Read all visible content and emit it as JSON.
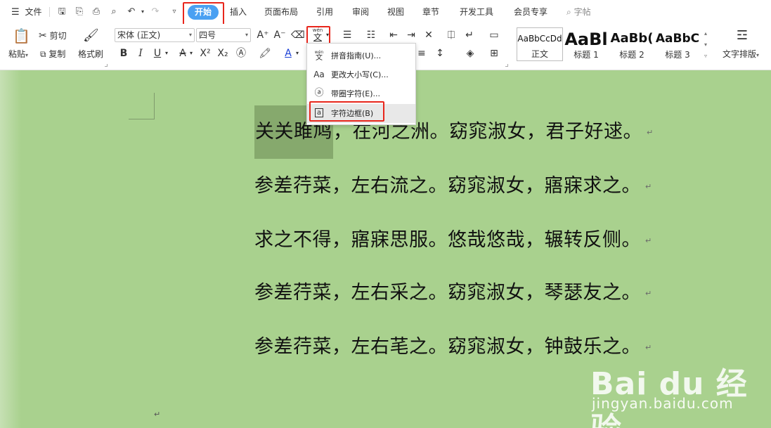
{
  "menubar": {
    "file_label": "文件",
    "tabs": [
      "开始",
      "插入",
      "页面布局",
      "引用",
      "审阅",
      "视图",
      "章节",
      "开发工具",
      "会员专享"
    ],
    "search_label": "字帖"
  },
  "ribbon": {
    "paste_label": "粘贴",
    "cut_label": "剪切",
    "copy_label": "复制",
    "format_painter_label": "格式刷",
    "font_name": "宋体 (正文)",
    "font_size": "四号",
    "styles": [
      {
        "sample": "AaBbCcDd",
        "name": "正文"
      },
      {
        "sample": "AaBl",
        "name": "标题 1"
      },
      {
        "sample": "AaBb(",
        "name": "标题 2"
      },
      {
        "sample": "AaBbC",
        "name": "标题 3"
      }
    ],
    "text_layout_label": "文字排版",
    "icon_glyphs": {
      "pinyin": "文",
      "pinyin_top": "wén"
    }
  },
  "dropdown": {
    "items": [
      {
        "label": "拼音指南(U)...",
        "icon": "pinyin-icon"
      },
      {
        "label": "更改大小写(C)...",
        "icon": "change-case-icon"
      },
      {
        "label": "带圈字符(E)...",
        "icon": "enclosed-char-icon"
      },
      {
        "label": "字符边框(B)",
        "icon": "char-border-icon"
      }
    ]
  },
  "document": {
    "lines": [
      {
        "selected": "关关雎鸠",
        "rest": "，在河之洲。窈窕淑女，君子好逑。"
      },
      {
        "selected": "",
        "rest": "参差荇菜，左右流之。窈窕淑女，寤寐求之。"
      },
      {
        "selected": "",
        "rest": "求之不得，寤寐思服。悠哉悠哉，辗转反侧。"
      },
      {
        "selected": "",
        "rest": "参差荇菜，左右采之。窈窕淑女，琴瑟友之。"
      },
      {
        "selected": "",
        "rest": "参差荇菜，左右芼之。窈窕淑女，钟鼓乐之。"
      }
    ],
    "paragraph_mark": "↵"
  },
  "watermark": {
    "brand": "Bai du 经验",
    "url": "jingyan.baidu.com"
  },
  "colors": {
    "accent": "#4aa0f2",
    "highlight_box": "#e8261c",
    "doc_background": "#a9d18e",
    "selection": "#86a96d"
  }
}
